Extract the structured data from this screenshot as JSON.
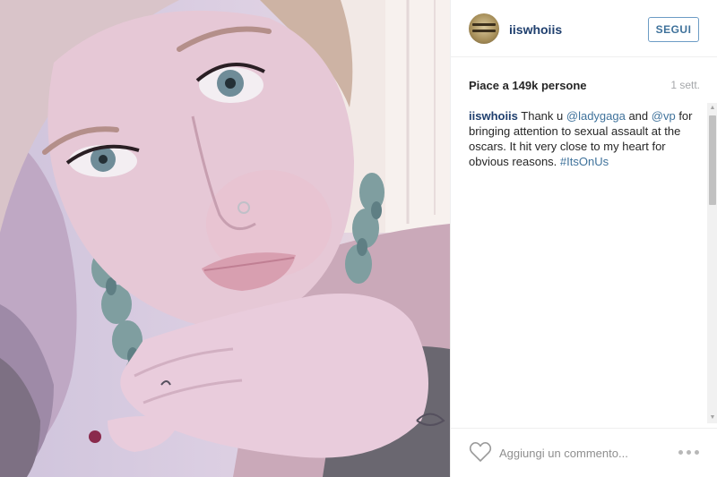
{
  "post": {
    "photo": {
      "icon": "photo-selfie",
      "colors": {
        "skin": "#e6c8d6",
        "eye": "#6f8c98",
        "braid": "#6f9094"
      }
    }
  },
  "header": {
    "username": "iiswhoiis",
    "follow_label": "SEGUI",
    "avatar_icon": "profile-avatar"
  },
  "meta": {
    "likes_text": "Piace a 149k persone",
    "time_text": "1 sett."
  },
  "caption": {
    "username": "iiswhoiis",
    "text_1": " Thank u ",
    "mention_1": "@ladygaga",
    "text_2": " and ",
    "mention_2": "@vp",
    "text_3": " for bringing attention to sexual assault at the oscars. It hit very close to my heart for obvious reasons. ",
    "hashtag": "#ItsOnUs"
  },
  "footer": {
    "like_icon": "heart-icon",
    "comment_placeholder": "Aggiungi un commento...",
    "more_icon": "more-options-icon"
  },
  "colors": {
    "link": "#3f729b",
    "username": "#1f3f6e",
    "muted": "#a5a7aa",
    "border": "#efefef"
  }
}
